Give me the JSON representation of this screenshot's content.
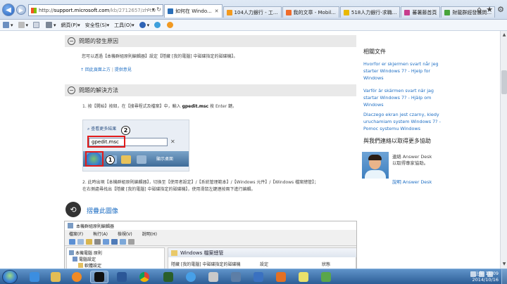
{
  "browser": {
    "address": {
      "prefix": "http://",
      "domain": "support.microsoft.com",
      "path": "/kb/2712657/zh-tw"
    },
    "tabs": [
      {
        "label": "如何在 Windo...",
        "color": "#2b6fb8",
        "active": true
      },
      {
        "label": "104人力銀行 - 工...",
        "color": "#f39a1e",
        "active": false
      },
      {
        "label": "我的文章 - Mobil...",
        "color": "#f06c2b",
        "active": false
      },
      {
        "label": "518人力銀行-求職...",
        "color": "#e9b800",
        "active": false
      },
      {
        "label": "蕃薯藤首頁",
        "color": "#c83d8d",
        "active": false
      },
      {
        "label": "財龍群經發展問...",
        "color": "#48a43b",
        "active": false
      }
    ],
    "command_bar": {
      "page_label": "網頁(P)",
      "safety_label": "安全性(S)",
      "tools_label": "工具(O)"
    }
  },
  "article": {
    "section1": {
      "heading": "問題的發生原因",
      "body": "您可以透過【本機群組原則編輯器】設定【隱藏 [我的電腦] 中磁碟指定的磁碟機】。",
      "back_to_top": "↑ 回此頁面上方",
      "feedback": "提供意見"
    },
    "section2": {
      "heading": "問題的解決方法",
      "step1_pre": "1. 按【開始】按鈕，在【搜尋程式及檔案】中，輸入",
      "step1_cmd": "gpedit.msc",
      "step1_post": "按 Enter 鍵。",
      "step2_line1": "2. 此時出現【本機群組原則編輯器】，切換至【使用者設定】/【系統管理範本】/【Windows 元件】/【Windows 檔案總管】；",
      "step2_line2": "在右側處尋找出【隱藏 [我的電腦] 中磁碟指定的磁碟機】，使用滑鼠左鍵連按兩下進行編輯。"
    },
    "figure": {
      "search_label": "查看更多結果",
      "input_value": "gpedit.msc",
      "desktop_label": "顯示桌面",
      "badge1": "1",
      "badge2": "2"
    },
    "rotate_label": "摺疊此圖像",
    "gp_editor": {
      "title": "本機群組原則編輯器",
      "menu": [
        "檔案(F)",
        "執行(A)",
        "檢視(V)",
        "說明(H)"
      ],
      "tree": [
        "本機電腦 原則",
        "電腦設定",
        "軟體設定"
      ],
      "folder_title": "Windows 檔案總管",
      "right_snippet": "隱藏 [我的電腦] 中磁碟指定的磁碟機",
      "col_setting": "設定",
      "col_state": "狀態"
    }
  },
  "sidebar": {
    "related_title": "相關文件",
    "related_links": [
      "Hvorfor er skjermen svart når jeg starter Windows 7? - Hjelp for Windows",
      "Varför är skärmen svart när jag startar Windows 7? - Hjälp om Windows",
      "Dlaczego ekran jest czarny, kiedy uruchamiam system Windows 7? - Pomoc systemu Windows"
    ],
    "contact_title": "與我們連絡以取得更多協助",
    "contact_text": "連絡 Answer Desk 以取得專家協助。",
    "contact_link": "說明 Answer Desk"
  },
  "taskbar": {
    "time": "上午 11:09",
    "date": "2014/10/16"
  },
  "colors": {
    "link": "#1f6fc4",
    "red_highlight": "#e21b1b"
  }
}
